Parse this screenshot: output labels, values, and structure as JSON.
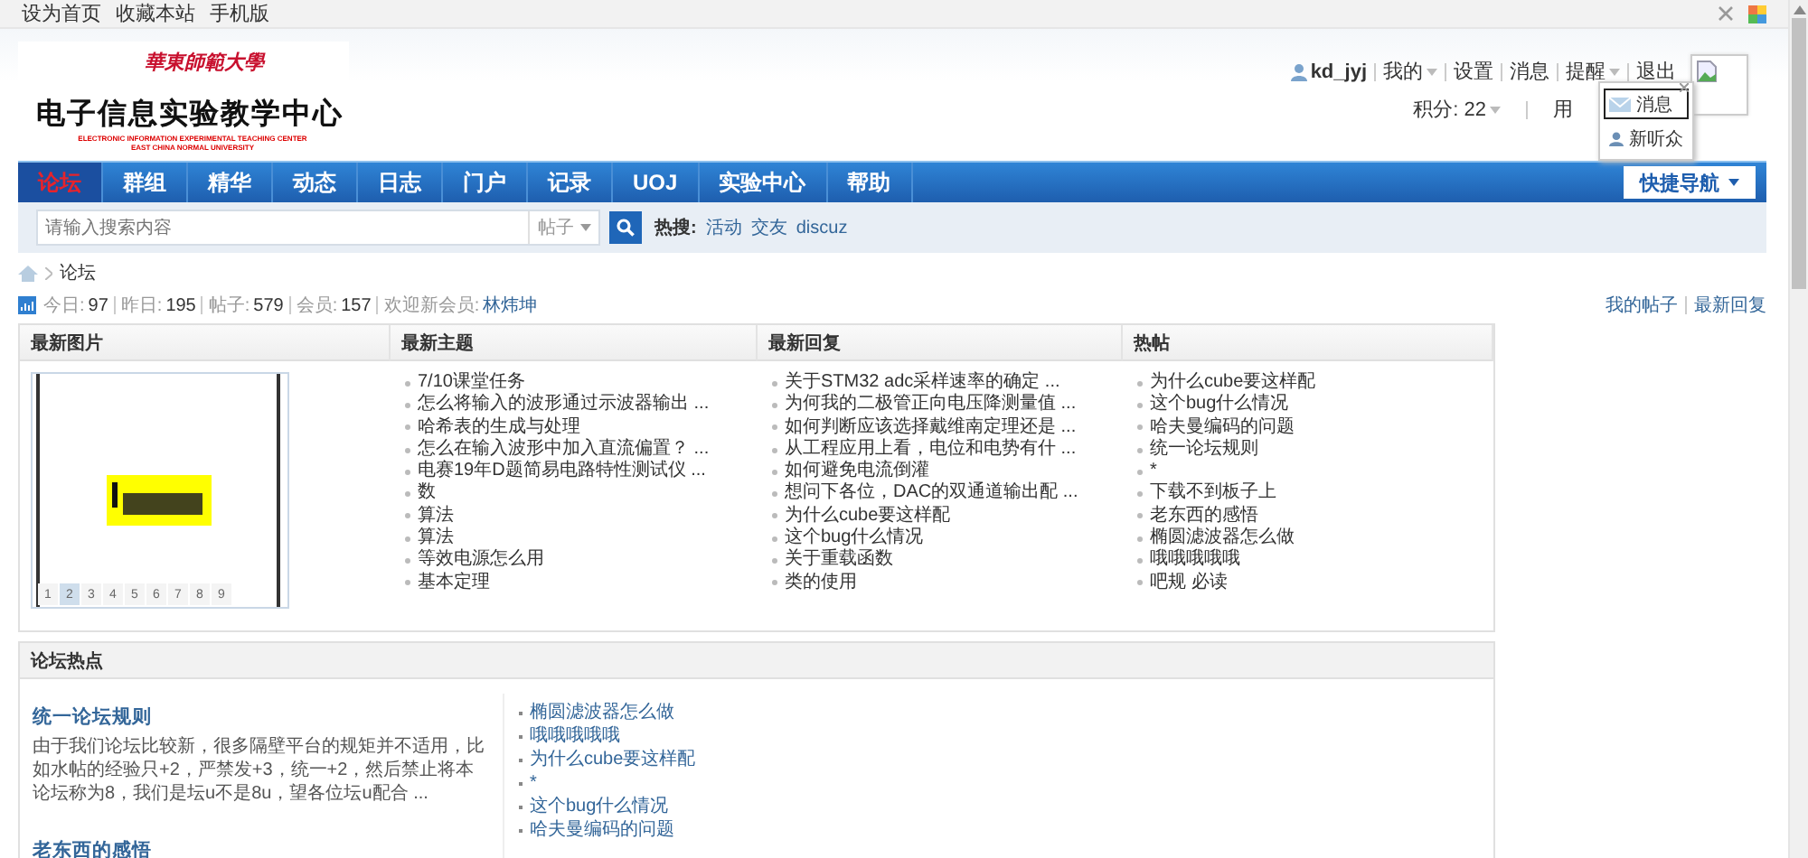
{
  "top_links": [
    "设为首页",
    "收藏本站",
    "手机版"
  ],
  "logo": {
    "university": "華東師範大學",
    "title": "电子信息实验教学中心",
    "subtitle_lines": [
      "ELECTRONIC INFORMATION EXPERIMENTAL TEACHING CENTER",
      "EAST CHINA NORMAL UNIVERSITY"
    ]
  },
  "user": {
    "name": "kd_jyj",
    "menu": [
      {
        "label": "我的",
        "dropdown": true
      },
      {
        "label": "设置",
        "dropdown": false
      },
      {
        "label": "消息",
        "dropdown": false
      },
      {
        "label": "提醒",
        "dropdown": true
      },
      {
        "label": "退出",
        "dropdown": false
      }
    ],
    "credits": "积分: 22",
    "group": "用"
  },
  "reminder_popup": {
    "items": [
      {
        "label": "消息",
        "kind": "mail",
        "selected": true
      },
      {
        "label": "新听众",
        "kind": "user",
        "selected": false
      }
    ]
  },
  "nav": [
    {
      "label": "论坛",
      "selected": true
    },
    {
      "label": "群组",
      "selected": false
    },
    {
      "label": "精华",
      "selected": false
    },
    {
      "label": "动态",
      "selected": false
    },
    {
      "label": "日志",
      "selected": false
    },
    {
      "label": "门户",
      "selected": false
    },
    {
      "label": "记录",
      "selected": false
    },
    {
      "label": "UOJ",
      "selected": false
    },
    {
      "label": "实验中心",
      "selected": false
    },
    {
      "label": "帮助",
      "selected": false
    }
  ],
  "quick_nav": "快捷导航",
  "search": {
    "placeholder": "请输入搜索内容",
    "scope": "帖子",
    "hot_label": "热搜:",
    "hot": [
      "活动",
      "交友",
      "discuz"
    ]
  },
  "breadcrumb": "论坛",
  "stats": [
    {
      "label": "今日:",
      "value": "97"
    },
    {
      "label": "昨日:",
      "value": "195"
    },
    {
      "label": "帖子:",
      "value": "579"
    },
    {
      "label": "会员:",
      "value": "157"
    }
  ],
  "new_member_label": "欢迎新会员:",
  "new_member": "林炜坤",
  "right_links": [
    "我的帖子",
    "最新回复"
  ],
  "panels": [
    {
      "title": "最新图片",
      "kind": "slideshow",
      "pages": [
        {
          "label": "1",
          "selected": false
        },
        {
          "label": "2",
          "selected": true
        },
        {
          "label": "3",
          "selected": false
        },
        {
          "label": "4",
          "selected": false
        },
        {
          "label": "5",
          "selected": false
        },
        {
          "label": "6",
          "selected": false
        },
        {
          "label": "7",
          "selected": false
        },
        {
          "label": "8",
          "selected": false
        },
        {
          "label": "9",
          "selected": false
        }
      ]
    },
    {
      "title": "最新主题",
      "kind": "list",
      "items": [
        "7/10课堂任务",
        "怎么将输入的波形通过示波器输出 ...",
        "哈希表的生成与处理",
        "怎么在输入波形中加入直流偏置？ ...",
        "电赛19年D题简易电路特性测试仪 ...",
        "数",
        "算法",
        "算法",
        "等效电源怎么用",
        "基本定理"
      ]
    },
    {
      "title": "最新回复",
      "kind": "list",
      "items": [
        "关于STM32 adc采样速率的确定 ...",
        "为何我的二极管正向电压降测量值 ...",
        "如何判断应该选择戴维南定理还是 ...",
        "从工程应用上看，电位和电势有什 ...",
        "如何避免电流倒灌",
        "想问下各位，DAC的双通道输出配 ...",
        "为什么cube要这样配",
        "这个bug什么情况",
        "关于重载函数",
        "类的使用"
      ]
    },
    {
      "title": "热帖",
      "kind": "list",
      "items": [
        "为什么cube要这样配",
        "这个bug什么情况",
        "哈夫曼编码的问题",
        "统一论坛规则",
        "*",
        "下载不到板子上",
        "老东西的感悟",
        "椭圆滤波器怎么做",
        "哦哦哦哦哦",
        "吧规 必读"
      ]
    }
  ],
  "hot_section": {
    "title": "论坛热点",
    "articles": [
      {
        "title": "统一论坛规则",
        "summary": "由于我们论坛比较新，很多隔壁平台的规矩并不适用，比如水帖的经验只+2，严禁发+3，统一+2，然后禁止将本论坛称为8，我们是坛u不是8u，望各位坛u配合 ..."
      },
      {
        "title": "老东西的感悟"
      }
    ],
    "links": [
      "椭圆滤波器怎么做",
      "哦哦哦哦哦",
      "为什么cube要这样配",
      "*",
      "这个bug什么情况",
      "哈夫曼编码的问题"
    ]
  }
}
